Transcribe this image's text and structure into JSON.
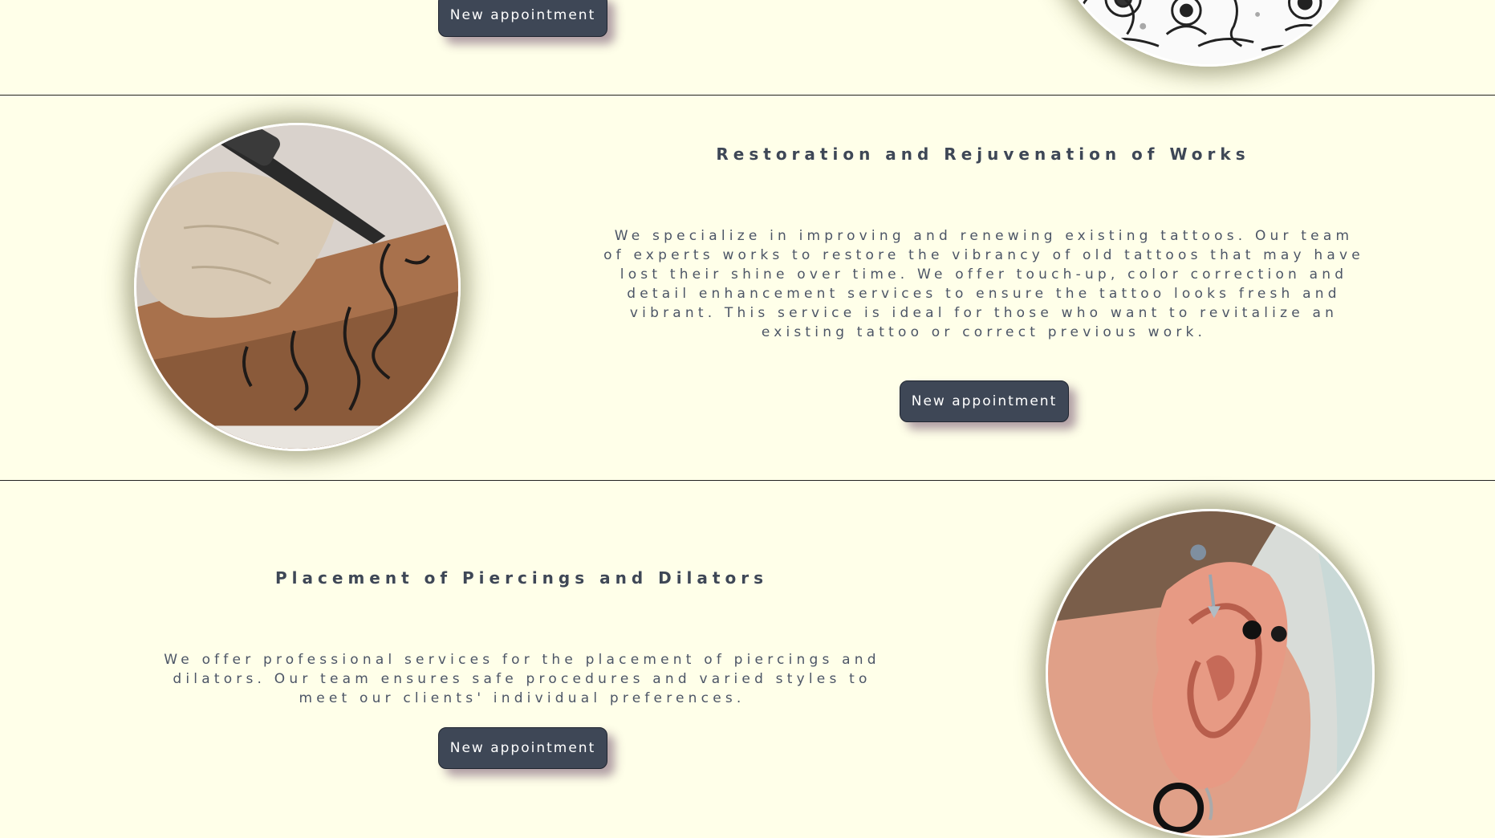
{
  "sections": {
    "top": {
      "button_label": "New appointment"
    },
    "restoration": {
      "title": "Restoration and Rejuvenation of Works",
      "description": "We specialize in improving and renewing existing tattoos. Our team of experts works to restore the vibrancy of old tattoos that may have lost their shine over time. We offer touch-up, color correction and detail enhancement services to ensure the tattoo looks fresh and vibrant. This service is ideal for those who want to revitalize an existing tattoo or correct previous work.",
      "button_label": "New appointment"
    },
    "piercing": {
      "title": "Placement of Piercings and Dilators",
      "description": "We offer professional services for the placement of piercings and dilators. Our team ensures safe procedures and varied styles to meet our clients' individual preferences.",
      "button_label": "New appointment"
    }
  },
  "colors": {
    "background": "#ffffe9",
    "button": "#3e4756",
    "text": "#3e4756"
  }
}
